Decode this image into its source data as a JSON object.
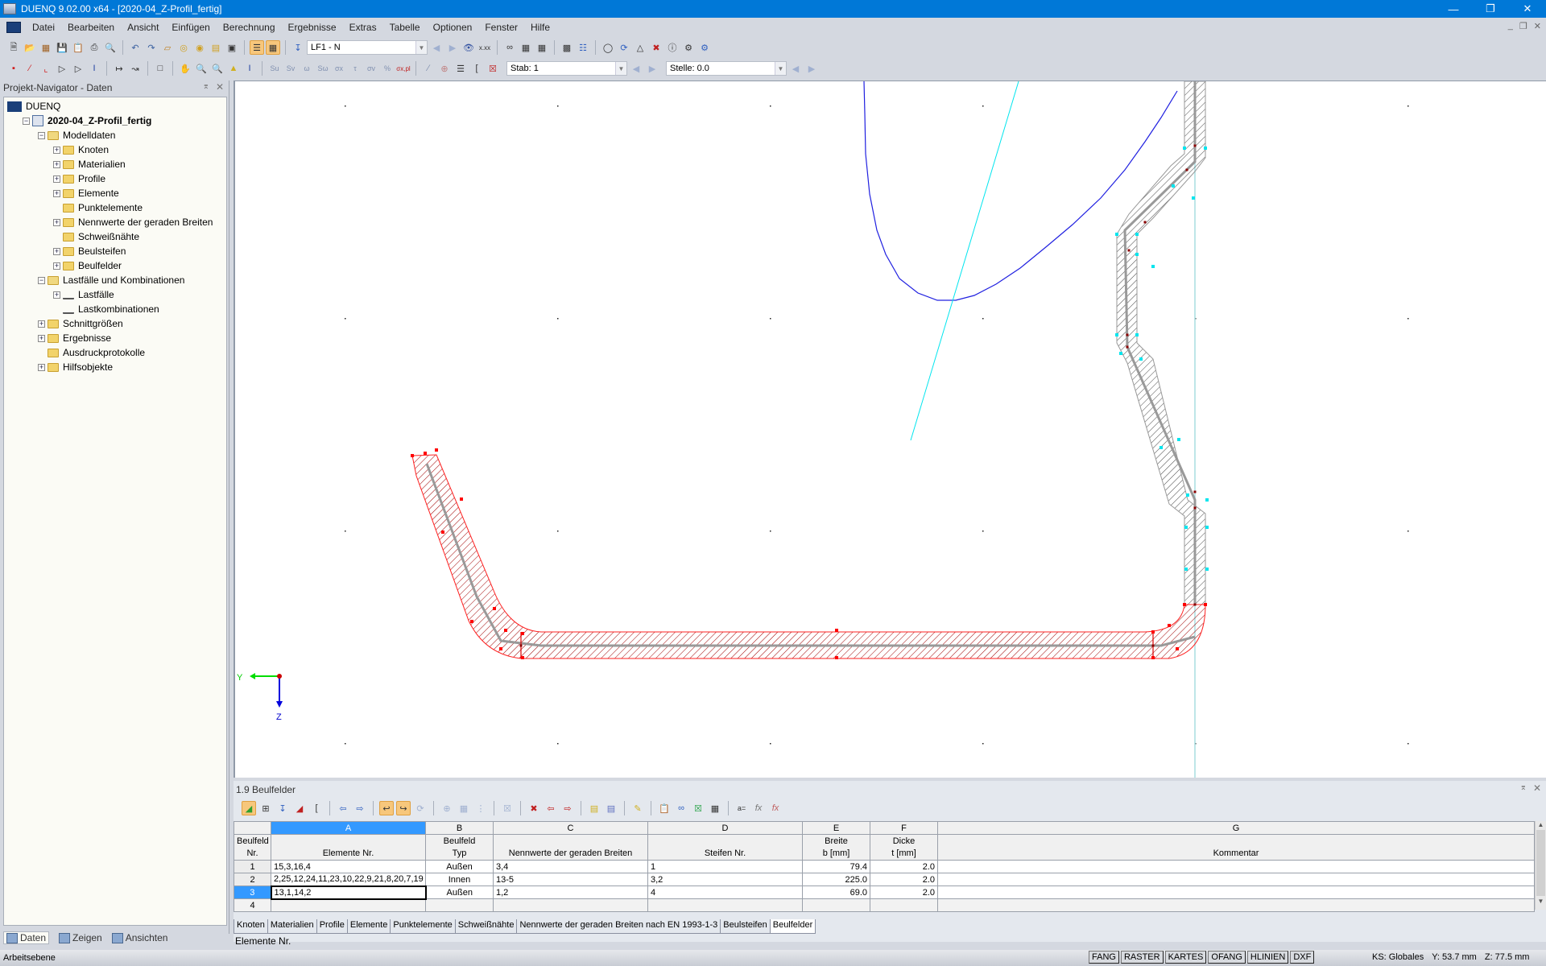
{
  "window": {
    "title": "DUENQ 9.02.00 x64 - [2020-04_Z-Profil_fertig]",
    "controls": [
      "minimize",
      "restore",
      "close"
    ]
  },
  "menu": [
    "Datei",
    "Bearbeiten",
    "Ansicht",
    "Einfügen",
    "Berechnung",
    "Ergebnisse",
    "Extras",
    "Tabelle",
    "Optionen",
    "Fenster",
    "Hilfe"
  ],
  "toolbar": {
    "loadcase_combo": "LF1 - N",
    "member_combo": "Stab: 1",
    "location_combo": "Stelle: 0.0"
  },
  "navigator": {
    "title": "Projekt-Navigator - Daten",
    "items": [
      {
        "label": "DUENQ",
        "level": 0,
        "icon": "app-logo-icon",
        "toggle": ""
      },
      {
        "label": "2020-04_Z-Profil_fertig",
        "level": 1,
        "icon": "project-icon",
        "toggle": "−",
        "bold": true
      },
      {
        "label": "Modelldaten",
        "level": 2,
        "icon": "folder-open-icon",
        "toggle": "−"
      },
      {
        "label": "Knoten",
        "level": 3,
        "icon": "folder-icon",
        "toggle": "+"
      },
      {
        "label": "Materialien",
        "level": 3,
        "icon": "folder-icon",
        "toggle": "+"
      },
      {
        "label": "Profile",
        "level": 3,
        "icon": "folder-icon",
        "toggle": "+"
      },
      {
        "label": "Elemente",
        "level": 3,
        "icon": "folder-icon",
        "toggle": "+"
      },
      {
        "label": "Punktelemente",
        "level": 3,
        "icon": "folder-icon",
        "toggle": ""
      },
      {
        "label": "Nennwerte der geraden Breiten",
        "level": 3,
        "icon": "folder-icon",
        "toggle": "+"
      },
      {
        "label": "Schweißnähte",
        "level": 3,
        "icon": "folder-icon",
        "toggle": ""
      },
      {
        "label": "Beulsteifen",
        "level": 3,
        "icon": "folder-icon",
        "toggle": "+"
      },
      {
        "label": "Beulfelder",
        "level": 3,
        "icon": "folder-icon",
        "toggle": "+"
      },
      {
        "label": "Lastfälle und Kombinationen",
        "level": 2,
        "icon": "folder-open-icon",
        "toggle": "−"
      },
      {
        "label": "Lastfälle",
        "level": 3,
        "icon": "load-icon",
        "toggle": "+"
      },
      {
        "label": "Lastkombinationen",
        "level": 3,
        "icon": "combination-icon",
        "toggle": ""
      },
      {
        "label": "Schnittgrößen",
        "level": 2,
        "icon": "folder-icon",
        "toggle": "+"
      },
      {
        "label": "Ergebnisse",
        "level": 2,
        "icon": "folder-icon",
        "toggle": "+"
      },
      {
        "label": "Ausdruckprotokolle",
        "level": 2,
        "icon": "folder-icon",
        "toggle": ""
      },
      {
        "label": "Hilfsobjekte",
        "level": 2,
        "icon": "folder-icon",
        "toggle": "+"
      }
    ],
    "tabs": [
      "Daten",
      "Zeigen",
      "Ansichten"
    ]
  },
  "viewport": {
    "axis_y_label": "Y",
    "axis_z_label": "Z"
  },
  "table_panel": {
    "title": "1.9 Beulfelder",
    "column_letters": [
      "A",
      "B",
      "C",
      "D",
      "E",
      "F",
      "G"
    ],
    "headers": {
      "rownum": [
        "Beulfeld",
        "Nr."
      ],
      "A": [
        "",
        "Elemente Nr."
      ],
      "B": [
        "Beulfeld",
        "Typ"
      ],
      "C": [
        "",
        "Nennwerte der geraden Breiten"
      ],
      "D": [
        "",
        "Steifen Nr."
      ],
      "E": [
        "Breite",
        "b [mm]"
      ],
      "F": [
        "Dicke",
        "t [mm]"
      ],
      "G": [
        "",
        "Kommentar"
      ]
    },
    "rows": [
      {
        "nr": "1",
        "elements": "15,3,16,4",
        "type": "Außen",
        "widths": "3,4",
        "stiffeners": "1",
        "b": "79.4",
        "t": "2.0",
        "comment": ""
      },
      {
        "nr": "2",
        "elements": "2,25,12,24,11,23,10,22,9,21,8,20,7,19",
        "type": "Innen",
        "widths": "13-5",
        "stiffeners": "3,2",
        "b": "225.0",
        "t": "2.0",
        "comment": ""
      },
      {
        "nr": "3",
        "elements": "13,1,14,2",
        "type": "Außen",
        "widths": "1,2",
        "stiffeners": "4",
        "b": "69.0",
        "t": "2.0",
        "comment": ""
      },
      {
        "nr": "4",
        "elements": "",
        "type": "",
        "widths": "",
        "stiffeners": "",
        "b": "",
        "t": "",
        "comment": ""
      }
    ],
    "selected_row": "3",
    "sheet_tabs": [
      "Knoten",
      "Materialien",
      "Profile",
      "Elemente",
      "Punktelemente",
      "Schweißnähte",
      "Nennwerte der geraden Breiten nach EN 1993-1-3",
      "Beulsteifen",
      "Beulfelder"
    ],
    "active_tab": "Beulfelder",
    "field_label": "Elemente Nr."
  },
  "statusbar": {
    "left": "Arbeitsebene",
    "toggles": [
      "FANG",
      "RASTER",
      "KARTES",
      "OFANG",
      "HLINIEN",
      "DXF"
    ],
    "ks": "KS: Globales",
    "y": "Y:  53.7 mm",
    "z": "Z:  77.5 mm"
  },
  "colors": {
    "title_bar": "#0078d7",
    "selection": "#3399ff",
    "panel_outer": "#ff0000",
    "panel_inner": "#777777",
    "node_cyan": "#00e5ee",
    "stress_curve": "#0000ee"
  }
}
